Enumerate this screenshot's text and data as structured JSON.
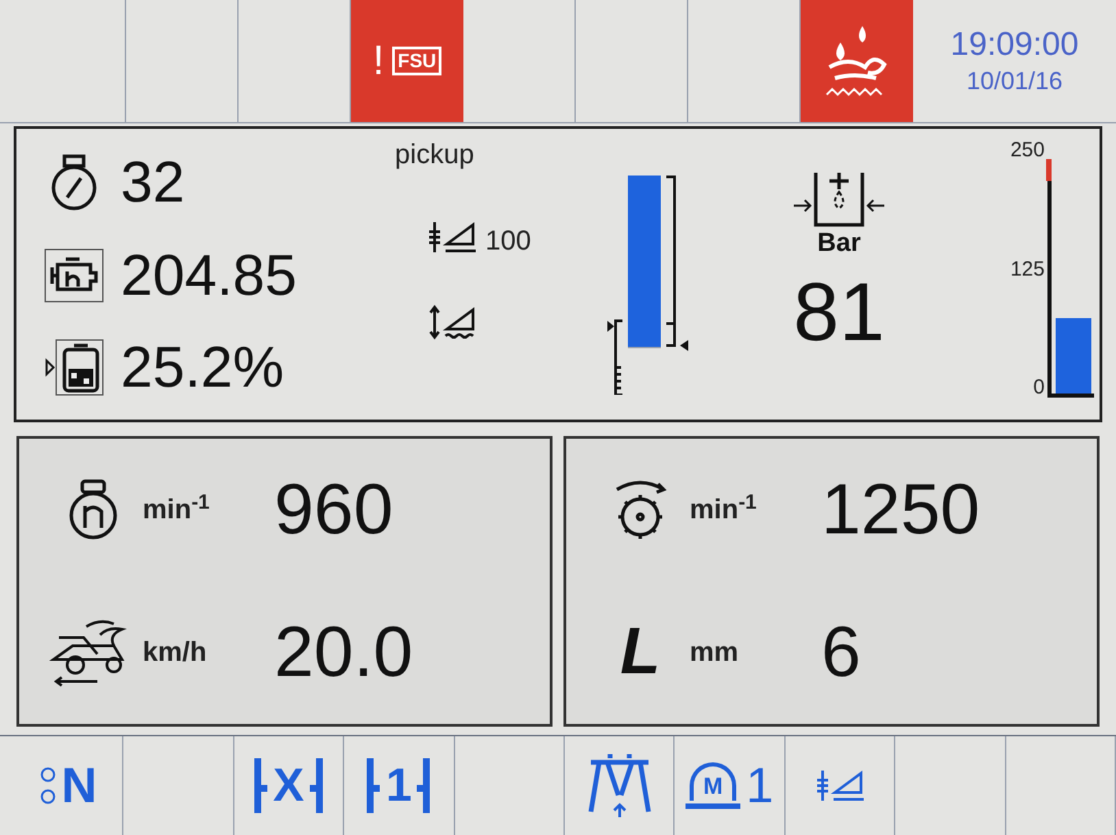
{
  "top_bar": {
    "cells": [
      {
        "kind": "empty"
      },
      {
        "kind": "empty"
      },
      {
        "kind": "empty"
      },
      {
        "kind": "fsu_alarm",
        "mark": "!",
        "label": "FSU"
      },
      {
        "kind": "empty"
      },
      {
        "kind": "empty"
      },
      {
        "kind": "empty"
      },
      {
        "kind": "water_alarm"
      }
    ],
    "time": "19:09:00",
    "date": "10/01/16"
  },
  "main_panel": {
    "readings": [
      {
        "kind": "gauge",
        "value": "32"
      },
      {
        "kind": "engine_hours",
        "value": "204.85"
      },
      {
        "kind": "fuel",
        "value": "25.2%"
      }
    ],
    "pickup": {
      "label": "pickup",
      "reading": "100",
      "level": 1
    },
    "pressure": {
      "unit": "Bar",
      "value": "81",
      "scale": [
        "250",
        "125",
        "0"
      ],
      "level": 0.32
    }
  },
  "bottom_panels": [
    {
      "rows": [
        {
          "kind": "engine_speed",
          "unit": "min$^{-1}$",
          "value": "960"
        },
        {
          "kind": "ground_speed",
          "unit": "km/h",
          "value": "20.0"
        }
      ]
    },
    {
      "rows": [
        {
          "kind": "cutter_speed",
          "unit": "min$^{-1}$",
          "value": "1250"
        },
        {
          "kind": "length",
          "symbol": "L",
          "unit": "mm",
          "value": "6"
        }
      ]
    }
  ],
  "bottom_bar": [
    {
      "kind": "neutral",
      "label": "N"
    },
    {
      "kind": "empty"
    },
    {
      "kind": "bracket",
      "label": "X"
    },
    {
      "kind": "bracket",
      "label": "1"
    },
    {
      "kind": "empty"
    },
    {
      "kind": "header"
    },
    {
      "kind": "memory",
      "label": "M",
      "sub": "1"
    },
    {
      "kind": "pickup_height"
    },
    {
      "kind": "empty"
    },
    {
      "kind": "empty"
    }
  ]
}
